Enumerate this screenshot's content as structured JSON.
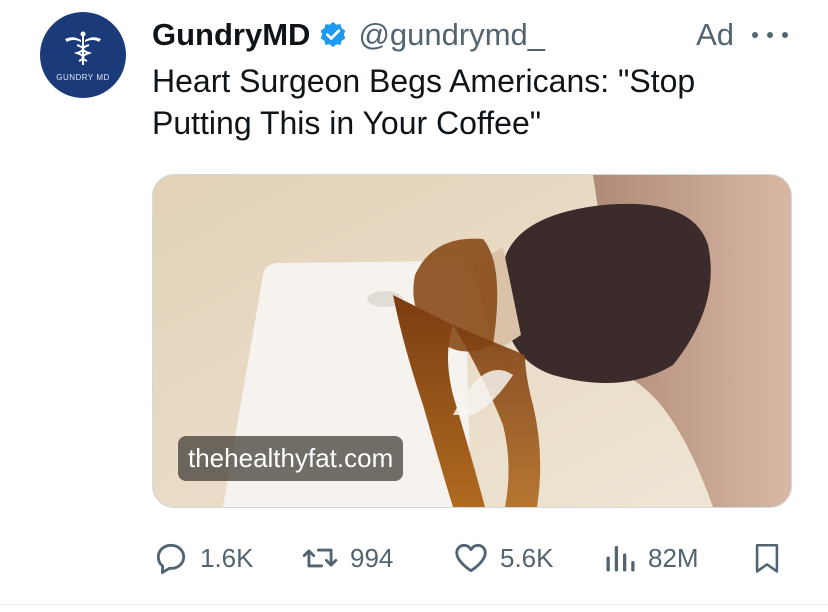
{
  "account": {
    "avatar_text": "GUNDRY MD",
    "display_name": "GundryMD",
    "handle": "@gundrymd_",
    "ad_label": "Ad"
  },
  "tweet": {
    "text": "Heart Surgeon Begs Americans: \"Stop Putting This in Your Coffee\""
  },
  "media": {
    "link_label": "thehealthyfat.com"
  },
  "actions": {
    "replies": "1.6K",
    "reposts": "994",
    "likes": "5.6K",
    "views": "82M"
  },
  "colors": {
    "verified": "#1d9bf0",
    "avatar_bg": "#1b3a7a",
    "muted_text": "#536471"
  },
  "icons": [
    "verified-badge-icon",
    "more-icon",
    "reply-icon",
    "repost-icon",
    "like-icon",
    "views-icon",
    "bookmark-icon"
  ]
}
